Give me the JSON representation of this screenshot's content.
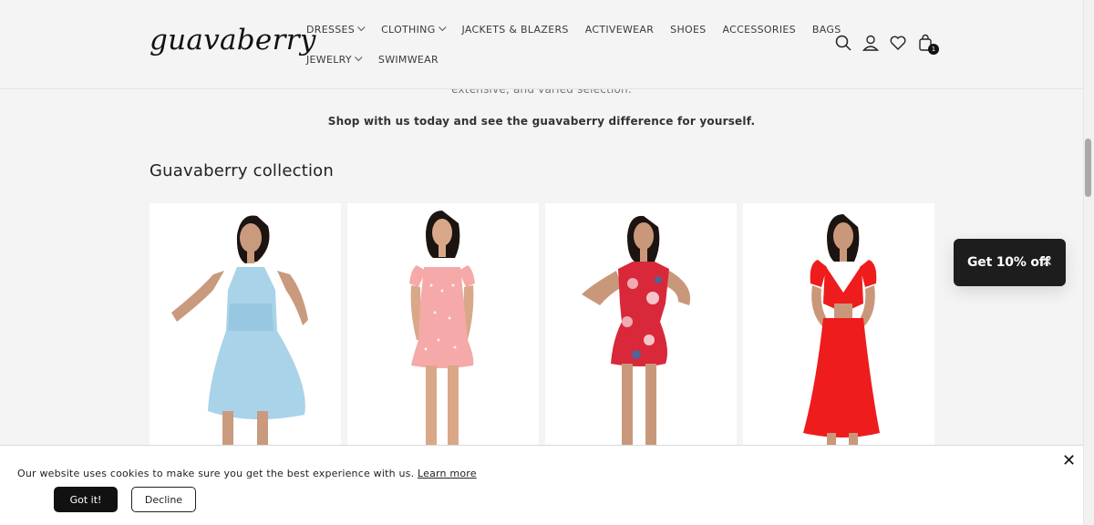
{
  "brand": {
    "logo_text": "guavaberry"
  },
  "nav": {
    "row1": [
      {
        "label": "DRESSES",
        "has_dropdown": true
      },
      {
        "label": "CLOTHING",
        "has_dropdown": true
      },
      {
        "label": "JACKETS & BLAZERS",
        "has_dropdown": false
      },
      {
        "label": "ACTIVEWEAR",
        "has_dropdown": false
      },
      {
        "label": "SHOES",
        "has_dropdown": false
      },
      {
        "label": "ACCESSORIES",
        "has_dropdown": false
      },
      {
        "label": "BAGS",
        "has_dropdown": false
      }
    ],
    "row2": [
      {
        "label": "JEWELRY",
        "has_dropdown": true
      },
      {
        "label": "SWIMWEAR",
        "has_dropdown": false
      }
    ]
  },
  "header_icons": {
    "search": "search-icon",
    "account": "account-icon",
    "wishlist": "heart-icon",
    "cart": "cart-icon",
    "cart_count": "1"
  },
  "intro": {
    "faded_line": "extensive, and varied selection.",
    "bold_line": "Shop with us today and see the guavaberry difference for yourself."
  },
  "collection": {
    "title": "Guavaberry collection",
    "products": [
      {
        "image_alt": "Light blue floral tie-strap mini dress",
        "dress_color": "#a9d3e8"
      },
      {
        "image_alt": "Pink polka dot puff-sleeve mini dress",
        "dress_color": "#f6a9a9"
      },
      {
        "image_alt": "Red floral print mini dress",
        "dress_color": "#d8283a"
      },
      {
        "image_alt": "Red tie-front puff-sleeve maxi dress",
        "dress_color": "#ee1c1c"
      }
    ]
  },
  "promo": {
    "label": "Get 10% off",
    "close": "✕"
  },
  "cookie": {
    "message": "Our website uses cookies to make sure you get the best experience with us.",
    "learn_more": "Learn more",
    "accept": "Got it!",
    "decline": "Decline",
    "close": "✕"
  },
  "colors": {
    "background": "#f4f4f4",
    "dark": "#111111",
    "promo_bg": "#1d1d1d"
  }
}
